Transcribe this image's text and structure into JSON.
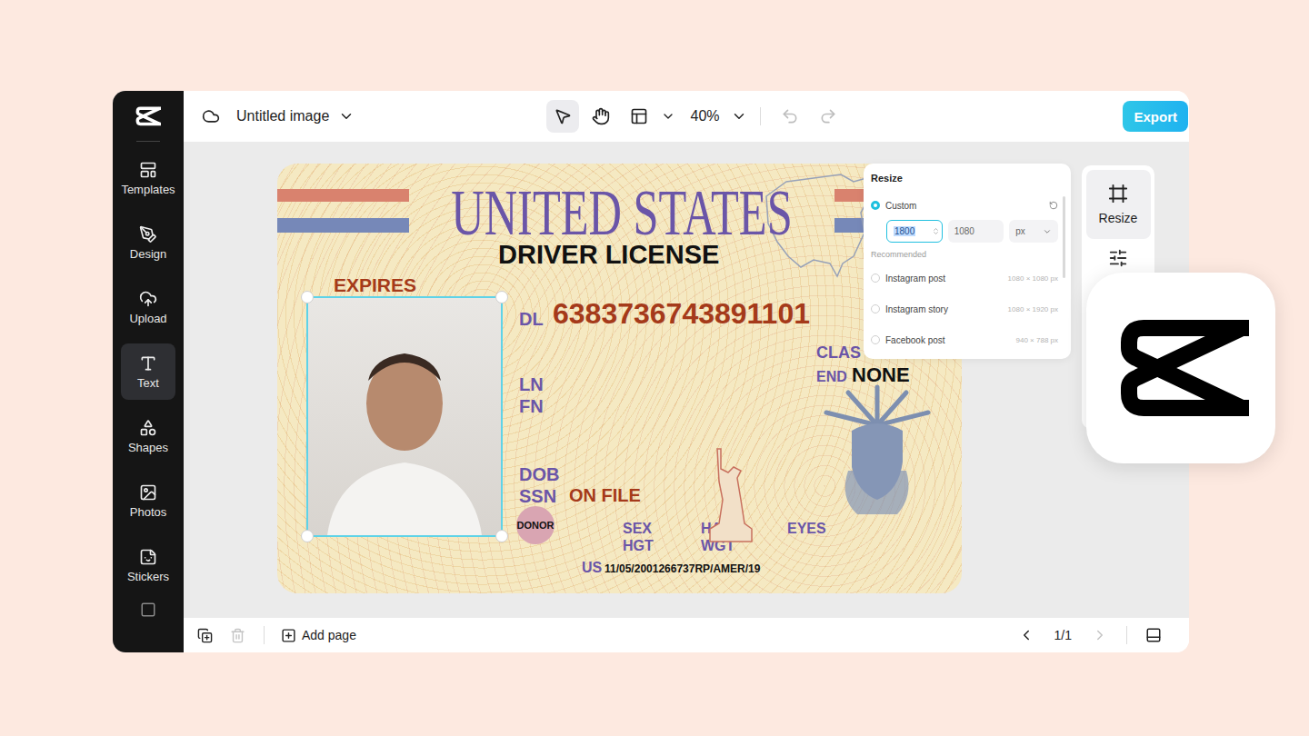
{
  "sidebar": {
    "items": [
      {
        "label": "Templates",
        "selected": false
      },
      {
        "label": "Design",
        "selected": false
      },
      {
        "label": "Upload",
        "selected": false
      },
      {
        "label": "Text",
        "selected": true
      },
      {
        "label": "Shapes",
        "selected": false
      },
      {
        "label": "Photos",
        "selected": false
      },
      {
        "label": "Stickers",
        "selected": false
      }
    ]
  },
  "topbar": {
    "title": "Untitled image",
    "zoom": "40%",
    "export": "Export",
    "tools": [
      {
        "kind": "select",
        "selected": true
      },
      {
        "kind": "hand",
        "selected": false
      }
    ],
    "undo": {
      "disabled": true
    },
    "redo": {
      "disabled": true
    }
  },
  "license": {
    "title": "UNITED STATES",
    "subtitle": "DRIVER LICENSE",
    "expires": "EXPIRES",
    "dl": {
      "label": "DL",
      "value": "6383736743891101"
    },
    "class_label": "CLAS",
    "end": {
      "label": "END",
      "value": "NONE"
    },
    "ln": "LN",
    "fn": "FN",
    "dob": "DOB",
    "ssn": {
      "label": "SSN",
      "value": "ON FILE"
    },
    "donor": "DONOR",
    "sex": "SEX",
    "hgt": "HGT",
    "hair": "HAIR",
    "wgt": "WGT",
    "eyes": "EYES",
    "us": {
      "label": "US",
      "value": "11/05/2001266737RP/AMER/19"
    },
    "photo_selected": true
  },
  "resize_panel": {
    "title": "Resize",
    "custom": {
      "label": "Custom",
      "selected": true,
      "width": "1800",
      "height": "1080",
      "unit": "px"
    },
    "recommended_label": "Recommended",
    "presets": [
      {
        "label": "Instagram post",
        "size": "1080 × 1080 px",
        "selected": false
      },
      {
        "label": "Instagram story",
        "size": "1080 × 1920 px",
        "selected": false
      },
      {
        "label": "Facebook post",
        "size": "940 × 788 px",
        "selected": false
      }
    ]
  },
  "side_tools": [
    {
      "label": "Resize",
      "selected": true
    }
  ],
  "bottom_bar": {
    "add_page": "Add page",
    "delete": {
      "disabled": true
    },
    "page": "1/1",
    "prev": {
      "disabled": false
    },
    "next": {
      "disabled": true
    }
  }
}
